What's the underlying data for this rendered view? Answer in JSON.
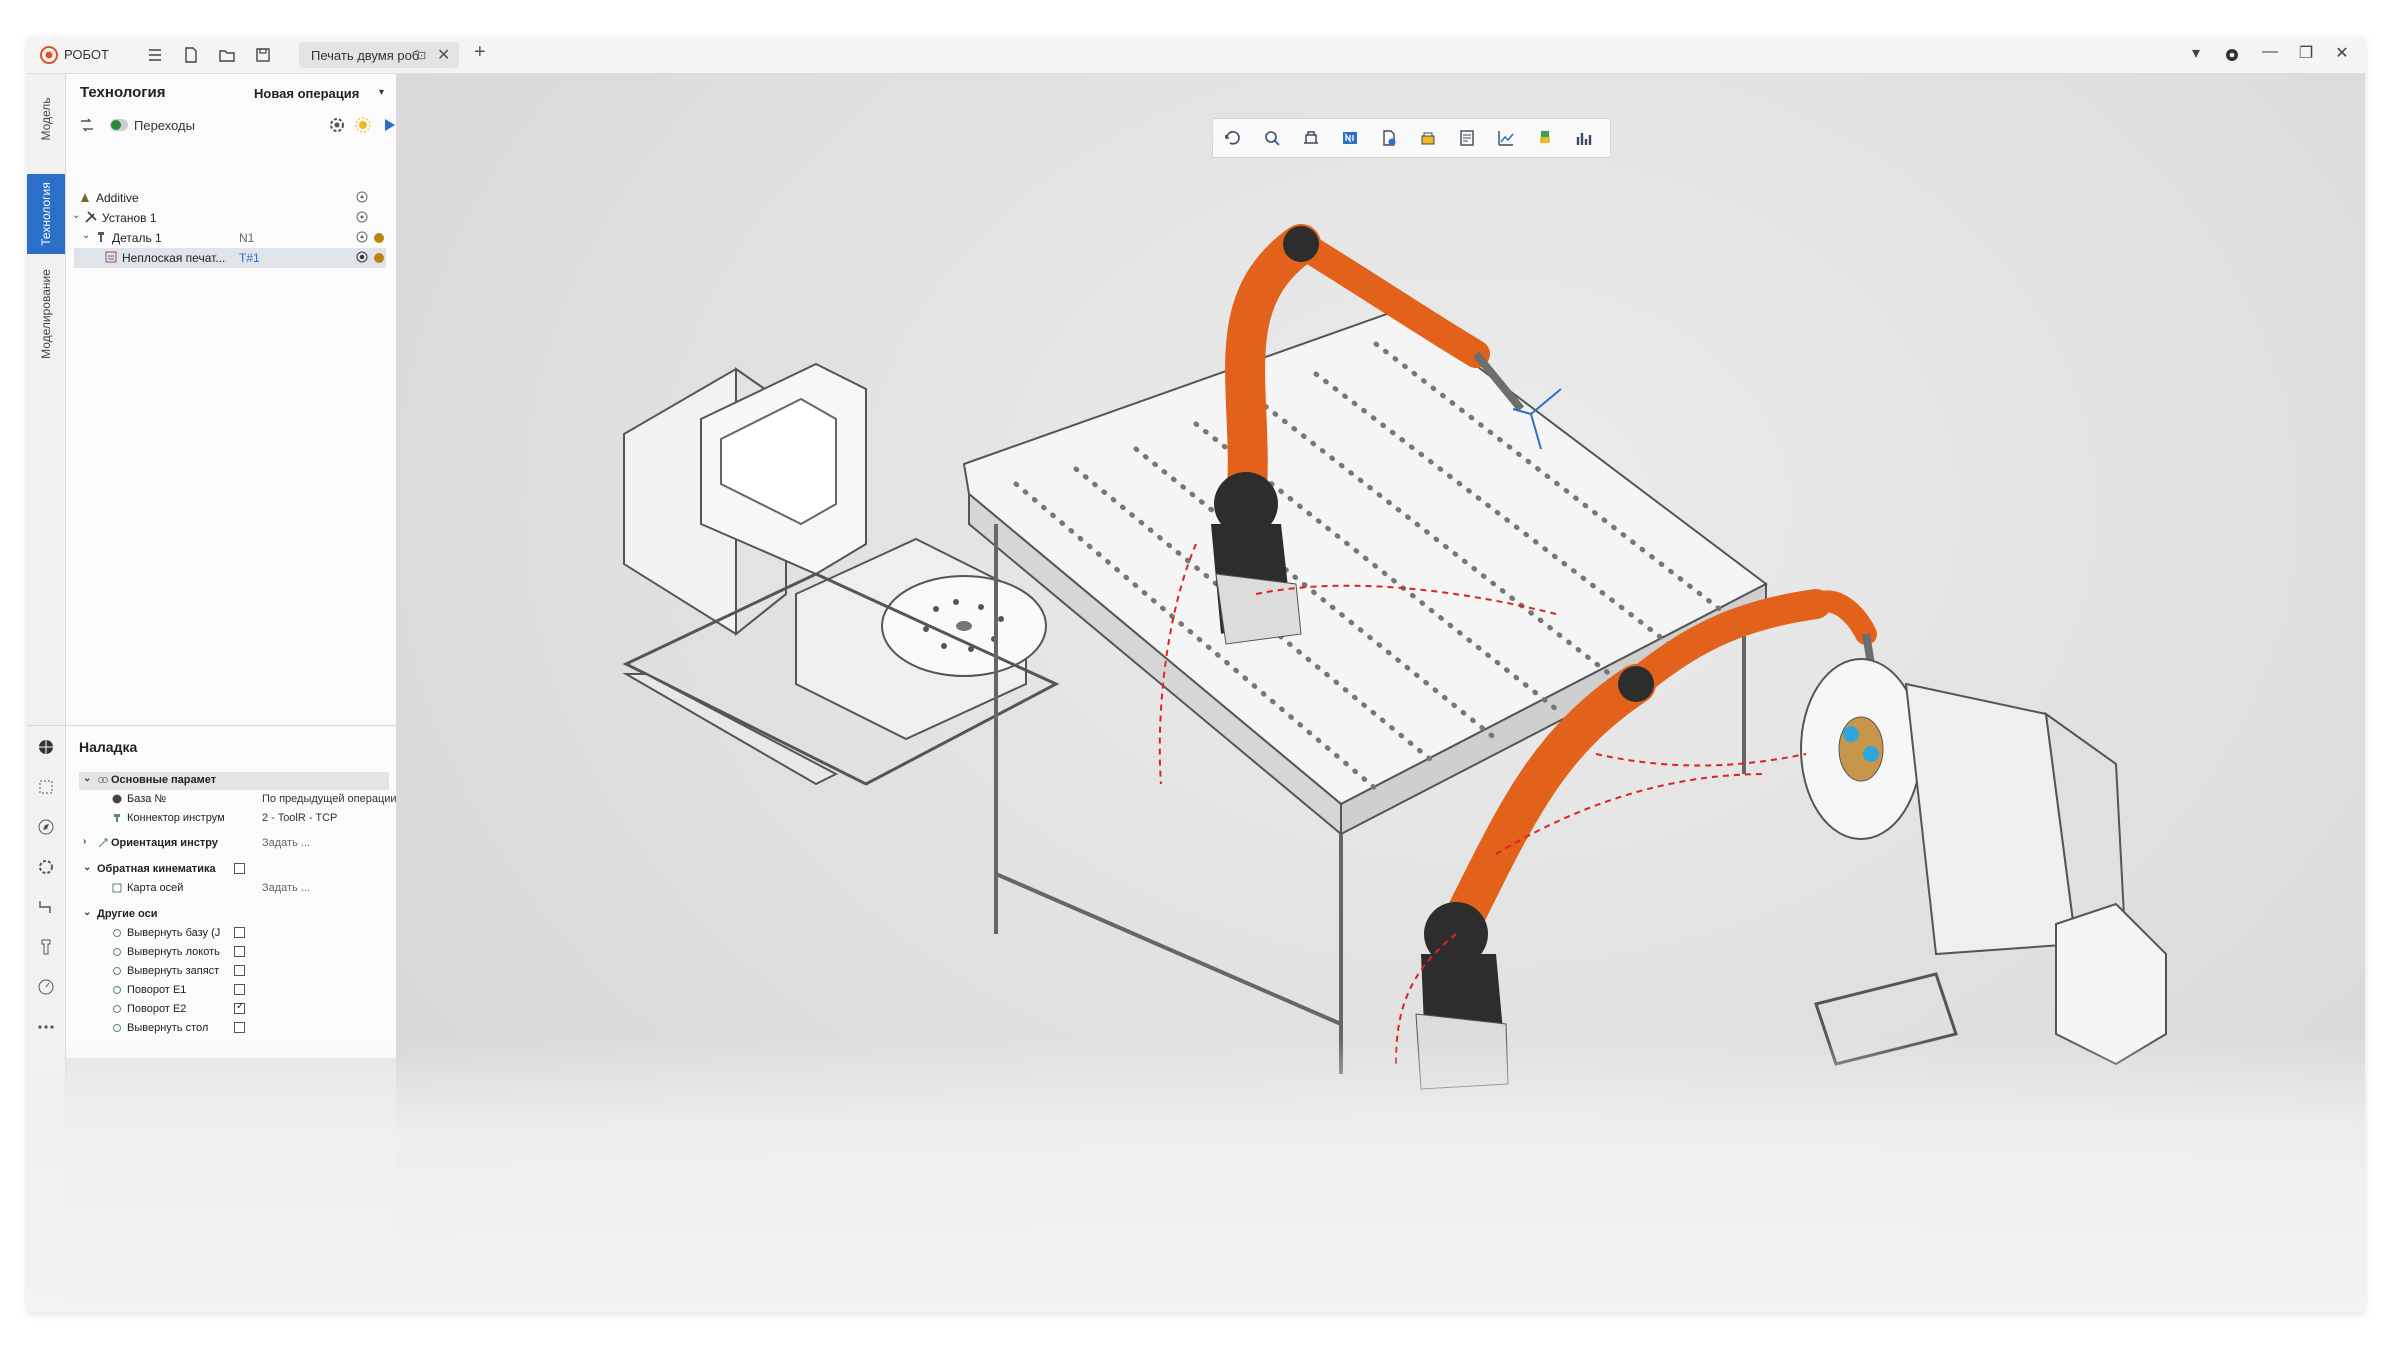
{
  "app": {
    "name": "РОБОТ",
    "accent": "#2b6fc9",
    "logo_color": "#e0522a"
  },
  "titlebar": {
    "icons": [
      "menu-icon",
      "new-file-icon",
      "open-folder-icon",
      "save-icon"
    ],
    "doc_tab": {
      "label": "Печать двумя роб",
      "pin_glyph": "⊡",
      "close_glyph": "✕"
    },
    "add_tab_glyph": "+",
    "window_controls": [
      "▾",
      "✖",
      "—",
      "❐",
      "✕"
    ]
  },
  "vertical_tabs": [
    {
      "label": "Модель",
      "active": false
    },
    {
      "label": "Технология",
      "active": true
    },
    {
      "label": "Моделирование",
      "active": false
    }
  ],
  "technology_panel": {
    "title": "Технология",
    "new_operation": "Новая операция",
    "dropdown_glyph": "▾",
    "transitions_label": "Переходы",
    "tree": [
      {
        "label": "Additive",
        "num": "",
        "level": 0,
        "arrow": "",
        "selected": false,
        "dot": false
      },
      {
        "label": "Установ 1",
        "num": "",
        "level": 0,
        "arrow": "⌄",
        "selected": false,
        "dot": false
      },
      {
        "label": "Деталь 1",
        "num": "N1",
        "level": 1,
        "arrow": "⌄",
        "selected": false,
        "dot": true
      },
      {
        "label": "Неплоская печат...",
        "num": "T#1",
        "level": 2,
        "arrow": "",
        "selected": true,
        "dot": true
      }
    ]
  },
  "setup_panel": {
    "title": "Наладка",
    "rows": [
      {
        "kind": "group",
        "arrow": "⌄",
        "name": "Основные парамет",
        "value": "",
        "checkbox": null,
        "indent": 0,
        "highlight": true
      },
      {
        "kind": "prop",
        "arrow": "",
        "name": "База №",
        "value": "По предыдущей операции",
        "checkbox": null,
        "indent": 1,
        "highlight": false
      },
      {
        "kind": "prop",
        "arrow": "",
        "name": "Коннектор инструм",
        "value": "2 - ToolR - TCP",
        "checkbox": null,
        "indent": 1,
        "highlight": false
      },
      {
        "kind": "group",
        "arrow": "›",
        "name": "Ориентация инстру",
        "value": "Задать ...",
        "checkbox": null,
        "indent": 0,
        "highlight": false
      },
      {
        "kind": "group",
        "arrow": "⌄",
        "name": "Обратная кинематика",
        "value": "",
        "checkbox": false,
        "indent": 0,
        "highlight": false
      },
      {
        "kind": "prop",
        "arrow": "",
        "name": "Карта осей",
        "value": "Задать ...",
        "checkbox": null,
        "indent": 1,
        "highlight": false
      },
      {
        "kind": "group",
        "arrow": "⌄",
        "name": "Другие оси",
        "value": "",
        "checkbox": null,
        "indent": 0,
        "highlight": false
      },
      {
        "kind": "prop",
        "arrow": "",
        "name": "Вывернуть базу (J",
        "value": "",
        "checkbox": false,
        "indent": 1,
        "highlight": false
      },
      {
        "kind": "prop",
        "arrow": "",
        "name": "Вывернуть локоть",
        "value": "",
        "checkbox": false,
        "indent": 1,
        "highlight": false
      },
      {
        "kind": "prop",
        "arrow": "",
        "name": "Вывернуть запяст",
        "value": "",
        "checkbox": false,
        "indent": 1,
        "highlight": false
      },
      {
        "kind": "prop",
        "arrow": "",
        "name": "Поворот E1",
        "value": "",
        "checkbox": false,
        "indent": 1,
        "highlight": false
      },
      {
        "kind": "prop",
        "arrow": "",
        "name": "Поворот E2",
        "value": "",
        "checkbox": true,
        "indent": 1,
        "highlight": false
      },
      {
        "kind": "prop",
        "arrow": "",
        "name": "Вывернуть стол",
        "value": "",
        "checkbox": false,
        "indent": 1,
        "highlight": false
      }
    ],
    "side_icons": [
      "sphere-icon",
      "select-box-icon",
      "compass-icon",
      "settings-icon",
      "path-icon",
      "tool-icon",
      "gauge-icon",
      "more-icon"
    ]
  },
  "viewport": {
    "toolbar_icons": [
      "rotate-view-icon",
      "inspect-icon",
      "machine-icon",
      "nc-icon",
      "check-icon",
      "fixture-icon",
      "report-icon",
      "chart-icon",
      "tool-holder-icon",
      "stats-icon"
    ],
    "right_toolbar_icons": [
      "fit-view-icon",
      "shaded-sphere-icon",
      "wireframe-box-icon",
      "view-front-icon",
      "view-back-icon",
      "view-top-icon",
      "view-iso-active-icon",
      "view-bottom-icon",
      "view-left-icon",
      "tool-icon",
      "part-icon",
      "stock-icon",
      "hatch-icon",
      "point-icon",
      "curve-icon",
      "surface-grid-icon",
      "surface-icon",
      "plane-icon",
      "plane-alt-icon"
    ],
    "robot_color": "#e2621b",
    "scene_items": [
      "positioner-left",
      "robot-arm-top",
      "welding-table",
      "robot-arm-bottom",
      "positioner-right"
    ]
  }
}
